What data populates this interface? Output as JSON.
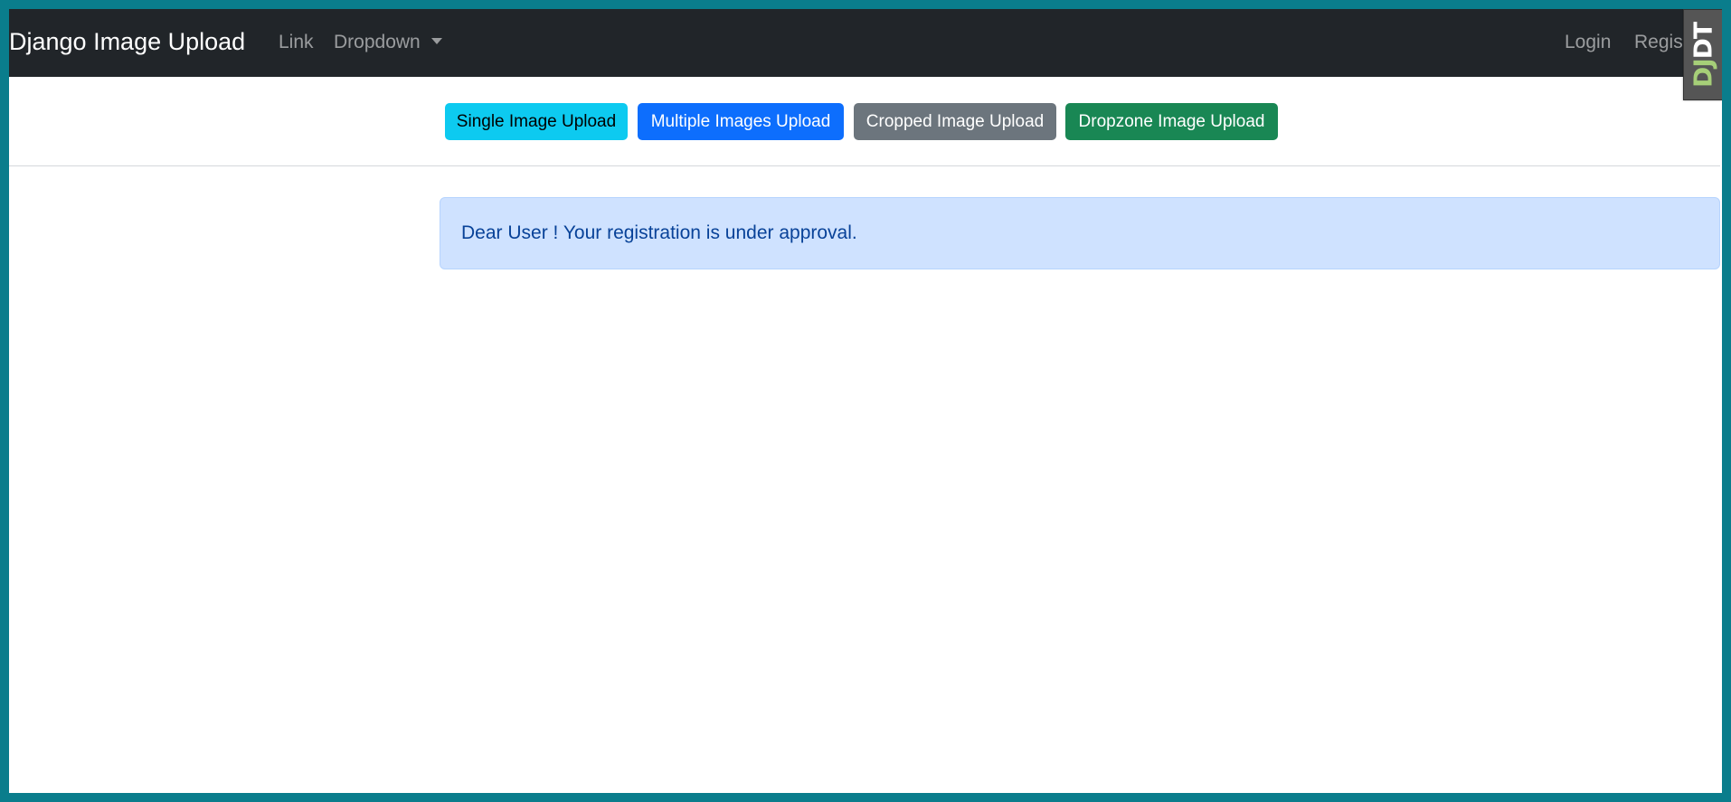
{
  "navbar": {
    "brand": "Django Image Upload",
    "link_label": "Link",
    "dropdown_label": "Dropdown",
    "login_label": "Login",
    "register_label": "Register"
  },
  "debug_toolbar": {
    "label_dj": "DJ",
    "label_dt": "DT"
  },
  "upload_buttons": [
    {
      "label": "Single Image Upload",
      "color": "#0dcaf0"
    },
    {
      "label": "Multiple Images Upload",
      "color": "#0d6efd"
    },
    {
      "label": "Cropped Image Upload",
      "color": "#6c757d"
    },
    {
      "label": "Dropzone Image Upload",
      "color": "#198754"
    }
  ],
  "alert": {
    "message": "Dear User ! Your registration is under approval.",
    "background": "#cfe2ff",
    "text_color": "#084298"
  },
  "colors": {
    "navbar_bg": "#212529",
    "frame_bg": "#0a7d8c"
  }
}
